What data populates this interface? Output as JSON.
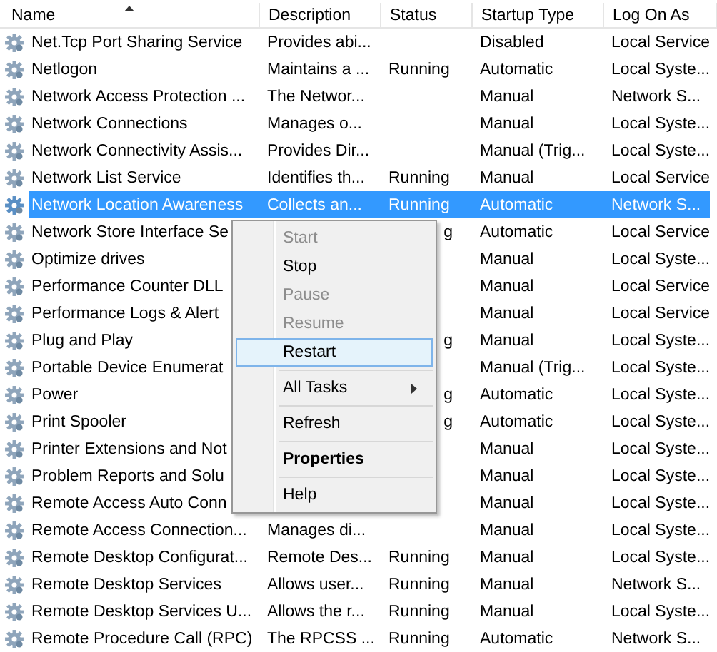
{
  "table": {
    "columns": [
      {
        "label": "Name",
        "sorted": true
      },
      {
        "label": "Description"
      },
      {
        "label": "Status"
      },
      {
        "label": "Startup Type"
      },
      {
        "label": "Log On As"
      }
    ],
    "rows": [
      {
        "selected": false,
        "cells": [
          {
            "text": "Net.Tcp Port Sharing Service"
          },
          {
            "text": "Provides abi..."
          },
          {
            "text": ""
          },
          {
            "text": "Disabled"
          },
          {
            "text": "Local Service"
          }
        ]
      },
      {
        "selected": false,
        "cells": [
          {
            "text": "Netlogon"
          },
          {
            "text": "Maintains a ..."
          },
          {
            "text": "Running"
          },
          {
            "text": "Automatic"
          },
          {
            "text": "Local Syste..."
          }
        ]
      },
      {
        "selected": false,
        "cells": [
          {
            "text": "Network Access Protection ..."
          },
          {
            "text": "The Networ..."
          },
          {
            "text": ""
          },
          {
            "text": "Manual"
          },
          {
            "text": "Network S..."
          }
        ]
      },
      {
        "selected": false,
        "cells": [
          {
            "text": "Network Connections"
          },
          {
            "text": "Manages o..."
          },
          {
            "text": ""
          },
          {
            "text": "Manual"
          },
          {
            "text": "Local Syste..."
          }
        ]
      },
      {
        "selected": false,
        "cells": [
          {
            "text": "Network Connectivity Assis..."
          },
          {
            "text": "Provides Dir..."
          },
          {
            "text": ""
          },
          {
            "text": "Manual (Trig..."
          },
          {
            "text": "Local Syste..."
          }
        ]
      },
      {
        "selected": false,
        "cells": [
          {
            "text": "Network List Service"
          },
          {
            "text": "Identifies th..."
          },
          {
            "text": "Running"
          },
          {
            "text": "Manual"
          },
          {
            "text": "Local Service"
          }
        ]
      },
      {
        "selected": true,
        "cells": [
          {
            "text": "Network Location Awareness"
          },
          {
            "text": "Collects an..."
          },
          {
            "text": "Running"
          },
          {
            "text": "Automatic"
          },
          {
            "text": "Network S..."
          }
        ]
      },
      {
        "selected": false,
        "cells": [
          {
            "text": "Network Store Interface Se"
          },
          {
            "text": ""
          },
          {
            "text": "g",
            "clipped": true
          },
          {
            "text": "Automatic"
          },
          {
            "text": "Local Service"
          }
        ]
      },
      {
        "selected": false,
        "cells": [
          {
            "text": "Optimize drives"
          },
          {
            "text": ""
          },
          {
            "text": ""
          },
          {
            "text": "Manual"
          },
          {
            "text": "Local Syste..."
          }
        ]
      },
      {
        "selected": false,
        "cells": [
          {
            "text": "Performance Counter DLL"
          },
          {
            "text": ""
          },
          {
            "text": ""
          },
          {
            "text": "Manual"
          },
          {
            "text": "Local Service"
          }
        ]
      },
      {
        "selected": false,
        "cells": [
          {
            "text": "Performance Logs & Alert"
          },
          {
            "text": ""
          },
          {
            "text": ""
          },
          {
            "text": "Manual"
          },
          {
            "text": "Local Service"
          }
        ]
      },
      {
        "selected": false,
        "cells": [
          {
            "text": "Plug and Play"
          },
          {
            "text": ""
          },
          {
            "text": "g",
            "clipped": true
          },
          {
            "text": "Manual"
          },
          {
            "text": "Local Syste..."
          }
        ]
      },
      {
        "selected": false,
        "cells": [
          {
            "text": "Portable Device Enumerat"
          },
          {
            "text": ""
          },
          {
            "text": ""
          },
          {
            "text": "Manual (Trig..."
          },
          {
            "text": "Local Syste..."
          }
        ]
      },
      {
        "selected": false,
        "cells": [
          {
            "text": "Power"
          },
          {
            "text": ""
          },
          {
            "text": "g",
            "clipped": true
          },
          {
            "text": "Automatic"
          },
          {
            "text": "Local Syste..."
          }
        ]
      },
      {
        "selected": false,
        "cells": [
          {
            "text": "Print Spooler"
          },
          {
            "text": ""
          },
          {
            "text": "g",
            "clipped": true
          },
          {
            "text": "Automatic"
          },
          {
            "text": "Local Syste..."
          }
        ]
      },
      {
        "selected": false,
        "cells": [
          {
            "text": "Printer Extensions and Not"
          },
          {
            "text": ""
          },
          {
            "text": ""
          },
          {
            "text": "Manual"
          },
          {
            "text": "Local Syste..."
          }
        ]
      },
      {
        "selected": false,
        "cells": [
          {
            "text": "Problem Reports and Solu"
          },
          {
            "text": ""
          },
          {
            "text": ""
          },
          {
            "text": "Manual"
          },
          {
            "text": "Local Syste..."
          }
        ]
      },
      {
        "selected": false,
        "cells": [
          {
            "text": "Remote Access Auto Conn"
          },
          {
            "text": ""
          },
          {
            "text": ""
          },
          {
            "text": "Manual"
          },
          {
            "text": "Local Syste..."
          }
        ]
      },
      {
        "selected": false,
        "cells": [
          {
            "text": "Remote Access Connection..."
          },
          {
            "text": "Manages di..."
          },
          {
            "text": ""
          },
          {
            "text": "Manual"
          },
          {
            "text": "Local Syste..."
          }
        ]
      },
      {
        "selected": false,
        "cells": [
          {
            "text": "Remote Desktop Configurat..."
          },
          {
            "text": "Remote Des..."
          },
          {
            "text": "Running"
          },
          {
            "text": "Manual"
          },
          {
            "text": "Local Syste..."
          }
        ]
      },
      {
        "selected": false,
        "cells": [
          {
            "text": "Remote Desktop Services"
          },
          {
            "text": "Allows user..."
          },
          {
            "text": "Running"
          },
          {
            "text": "Manual"
          },
          {
            "text": "Network S..."
          }
        ]
      },
      {
        "selected": false,
        "cells": [
          {
            "text": "Remote Desktop Services U..."
          },
          {
            "text": "Allows the r..."
          },
          {
            "text": "Running"
          },
          {
            "text": "Manual"
          },
          {
            "text": "Local Syste..."
          }
        ]
      },
      {
        "selected": false,
        "cells": [
          {
            "text": "Remote Procedure Call (RPC)"
          },
          {
            "text": "The RPCSS ..."
          },
          {
            "text": "Running"
          },
          {
            "text": "Automatic"
          },
          {
            "text": "Network S..."
          }
        ]
      }
    ]
  },
  "context_menu": {
    "items": [
      {
        "kind": "item",
        "label": "Start",
        "disabled": true,
        "highlighted": false,
        "default": false,
        "submenu": false
      },
      {
        "kind": "item",
        "label": "Stop",
        "disabled": false,
        "highlighted": false,
        "default": false,
        "submenu": false
      },
      {
        "kind": "item",
        "label": "Pause",
        "disabled": true,
        "highlighted": false,
        "default": false,
        "submenu": false
      },
      {
        "kind": "item",
        "label": "Resume",
        "disabled": true,
        "highlighted": false,
        "default": false,
        "submenu": false
      },
      {
        "kind": "item",
        "label": "Restart",
        "disabled": false,
        "highlighted": true,
        "default": false,
        "submenu": false
      },
      {
        "kind": "separator"
      },
      {
        "kind": "item",
        "label": "All Tasks",
        "disabled": false,
        "highlighted": false,
        "default": false,
        "submenu": true
      },
      {
        "kind": "separator"
      },
      {
        "kind": "item",
        "label": "Refresh",
        "disabled": false,
        "highlighted": false,
        "default": false,
        "submenu": false
      },
      {
        "kind": "separator"
      },
      {
        "kind": "item",
        "label": "Properties",
        "disabled": false,
        "highlighted": false,
        "default": true,
        "submenu": false
      },
      {
        "kind": "separator"
      },
      {
        "kind": "item",
        "label": "Help",
        "disabled": false,
        "highlighted": false,
        "default": false,
        "submenu": false
      }
    ]
  }
}
